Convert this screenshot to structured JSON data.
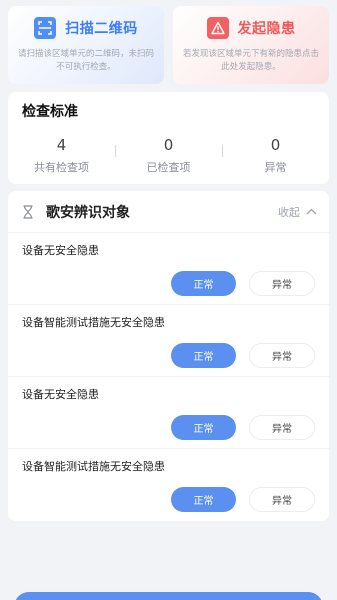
{
  "scan_card": {
    "title": "扫描二维码",
    "desc": "请扫描该区域单元的二维码，未扫码不可执行检查。",
    "icon": "qr-scan-icon",
    "color": "#3d7ef2"
  },
  "report_card": {
    "title": "发起隐患",
    "desc": "若发现该区域单元下有新的隐患点击此处发起隐患。",
    "icon": "warning-icon",
    "color": "#ee5a5a"
  },
  "standard": {
    "title": "检查标准",
    "stats": [
      {
        "value": "4",
        "label": "共有检查项"
      },
      {
        "value": "0",
        "label": "已检查项"
      },
      {
        "value": "0",
        "label": "异常"
      }
    ]
  },
  "object": {
    "title": "歌安辨识对象",
    "collapse_label": "收起",
    "icon": "hourglass-icon",
    "items": [
      {
        "label": "设备无安全隐患",
        "normal_label": "正常",
        "abnormal_label": "异常"
      },
      {
        "label": "设备智能测试措施无安全隐患",
        "normal_label": "正常",
        "abnormal_label": "异常"
      },
      {
        "label": "设备无安全隐患",
        "normal_label": "正常",
        "abnormal_label": "异常"
      },
      {
        "label": "设备智能测试措施无安全隐患",
        "normal_label": "正常",
        "abnormal_label": "异常"
      }
    ]
  },
  "colors": {
    "primary": "#5b8ff0",
    "danger": "#ee5a5a",
    "background": "#f2f3f7"
  }
}
